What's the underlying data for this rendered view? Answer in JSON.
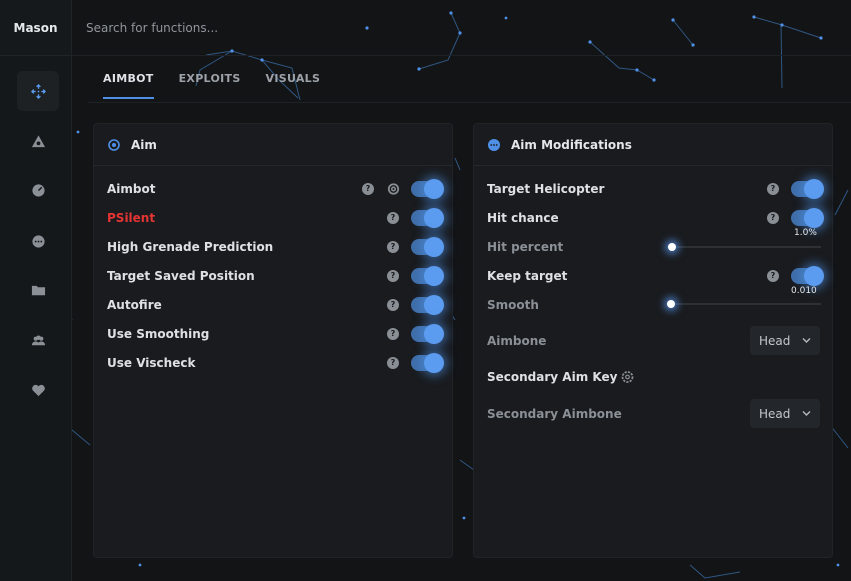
{
  "app": {
    "name": "Mason"
  },
  "search": {
    "placeholder": "Search for functions..."
  },
  "sidebar": {
    "items": [
      {
        "icon": "crosshair-icon",
        "active": true
      },
      {
        "icon": "eye-triangle-icon"
      },
      {
        "icon": "gauge-icon"
      },
      {
        "icon": "more-icon"
      },
      {
        "icon": "folder-icon"
      },
      {
        "icon": "users-icon"
      },
      {
        "icon": "heart-icon"
      }
    ]
  },
  "tabs": [
    {
      "label": "AIMBOT",
      "active": true
    },
    {
      "label": "EXPLOITS"
    },
    {
      "label": "VISUALS"
    }
  ],
  "aim_panel": {
    "title": "Aim",
    "rows": [
      {
        "label": "Aimbot",
        "enabled": true,
        "has_gear": true
      },
      {
        "label": "PSilent",
        "enabled": true
      },
      {
        "label": "High Grenade Prediction",
        "enabled": true
      },
      {
        "label": "Target Saved Position",
        "enabled": true
      },
      {
        "label": "Autofire",
        "enabled": true
      },
      {
        "label": "Use Smoothing",
        "enabled": true
      },
      {
        "label": "Use Vischeck",
        "enabled": true
      }
    ]
  },
  "mod_panel": {
    "title": "Aim Modifications",
    "target_helicopter": {
      "label": "Target Helicopter",
      "enabled": true
    },
    "hit_chance": {
      "label": "Hit chance",
      "enabled": true
    },
    "hit_percent": {
      "label": "Hit percent",
      "value_text": "1.0%",
      "fraction": 0.01
    },
    "keep_target": {
      "label": "Keep target",
      "enabled": true
    },
    "smooth": {
      "label": "Smooth",
      "value_text": "0.010",
      "fraction": 0.0
    },
    "aimbone": {
      "label": "Aimbone",
      "value": "Head"
    },
    "secondary_key": {
      "label": "Secondary Aim Key"
    },
    "secondary_aimbone": {
      "label": "Secondary Aimbone",
      "value": "Head"
    }
  },
  "colors": {
    "accent": "#4f8fe6",
    "danger": "#e43434",
    "panel": "#191b1e",
    "background": "#121416"
  },
  "help_glyph": "?"
}
